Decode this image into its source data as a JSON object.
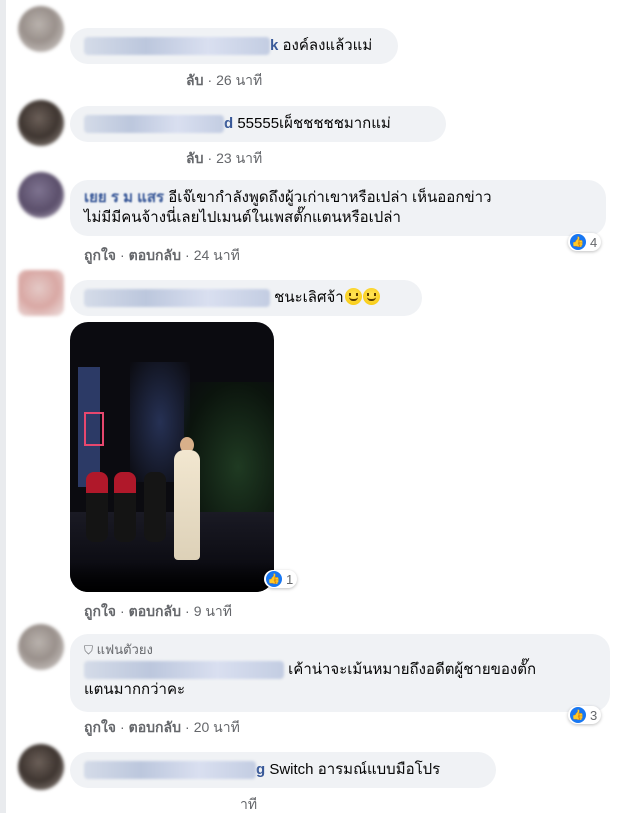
{
  "comments": [
    {
      "name_tail": "k",
      "text": "องค์ลงแล้วแม่",
      "reply_label": "ลับ",
      "time": "26 นาที"
    },
    {
      "name_tail": "d",
      "text": "55555เผ็ชชชชชมากแม่",
      "reply_label": "ลับ",
      "time": "23 นาที"
    },
    {
      "name_partial": "เยย ร ม แสร",
      "text_line1": "อีเจ๊เขากำลังพูดถึงผู้วเก่าเขาหรือเปล่า เห็นออกข่าว",
      "text_line2": "ไม่มีมีคนจ้างนี่เลยไปเมนต์ในเพสตั๊กแตนหรือเปล่า",
      "like_label": "ถูกใจ",
      "reply_label": "ตอบกลับ",
      "time": "24 นาที",
      "reaction_count": "4"
    },
    {
      "text": "ชนะเลิศจ้า",
      "like_label": "ถูกใจ",
      "reply_label": "ตอบกลับ",
      "time": "9 นาที",
      "reaction_count": "1"
    },
    {
      "badge": "แฟนตัวยง",
      "text_line1": "เค้าน่าจะเม้นหมายถึงอดีตผู้ชายของตั๊ก",
      "text_line2": "แตนมากกว่าคะ",
      "like_label": "ถูกใจ",
      "reply_label": "ตอบกลับ",
      "time": "20 นาที",
      "reaction_count": "3"
    },
    {
      "name_tail": "g",
      "text": "Switch อารมณ์แบบมือโปร",
      "time_partial": "าที"
    }
  ],
  "sep": "·",
  "icons": {
    "like": "thumbs-up-icon",
    "emoji": "grinning-face-icon",
    "badge": "shield-icon"
  },
  "colors": {
    "bubble": "#f0f2f5",
    "like_blue": "#1877f2",
    "name_blue": "#385898",
    "meta_gray": "#65676b"
  }
}
